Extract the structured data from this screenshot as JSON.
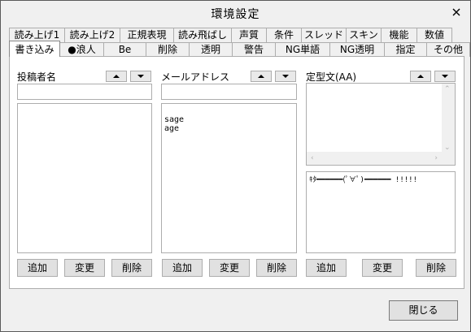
{
  "window": {
    "title": "環境設定"
  },
  "tabs": {
    "row1": [
      "読み上げ1",
      "読み上げ2",
      "正規表現",
      "読み飛ばし",
      "声質",
      "条件",
      "スレッド",
      "スキン",
      "機能",
      "数値"
    ],
    "row2": [
      "書き込み",
      "●浪人",
      "Be",
      "削除",
      "透明",
      "警告",
      "NG単語",
      "NG透明",
      "指定",
      "その他"
    ],
    "active": "書き込み"
  },
  "poster": {
    "label": "投稿者名",
    "field_value": "",
    "items": [],
    "buttons": {
      "add": "追加",
      "change": "変更",
      "delete": "削除"
    }
  },
  "mail": {
    "label": "メールアドレス",
    "field_value": "",
    "items": [
      "sage",
      "age"
    ],
    "buttons": {
      "add": "追加",
      "change": "変更",
      "delete": "削除"
    }
  },
  "template": {
    "label": "定型文(AA)",
    "aa_text": "ｷﾀ━━━━━━(ﾟ∀ﾟ)━━━━━━ !!!!!",
    "buttons": {
      "add": "追加",
      "change": "変更",
      "delete": "削除"
    }
  },
  "footer": {
    "close_label": "閉じる"
  },
  "icons": {
    "close": "close-icon",
    "up": "up-arrow-icon",
    "down": "down-arrow-icon"
  }
}
